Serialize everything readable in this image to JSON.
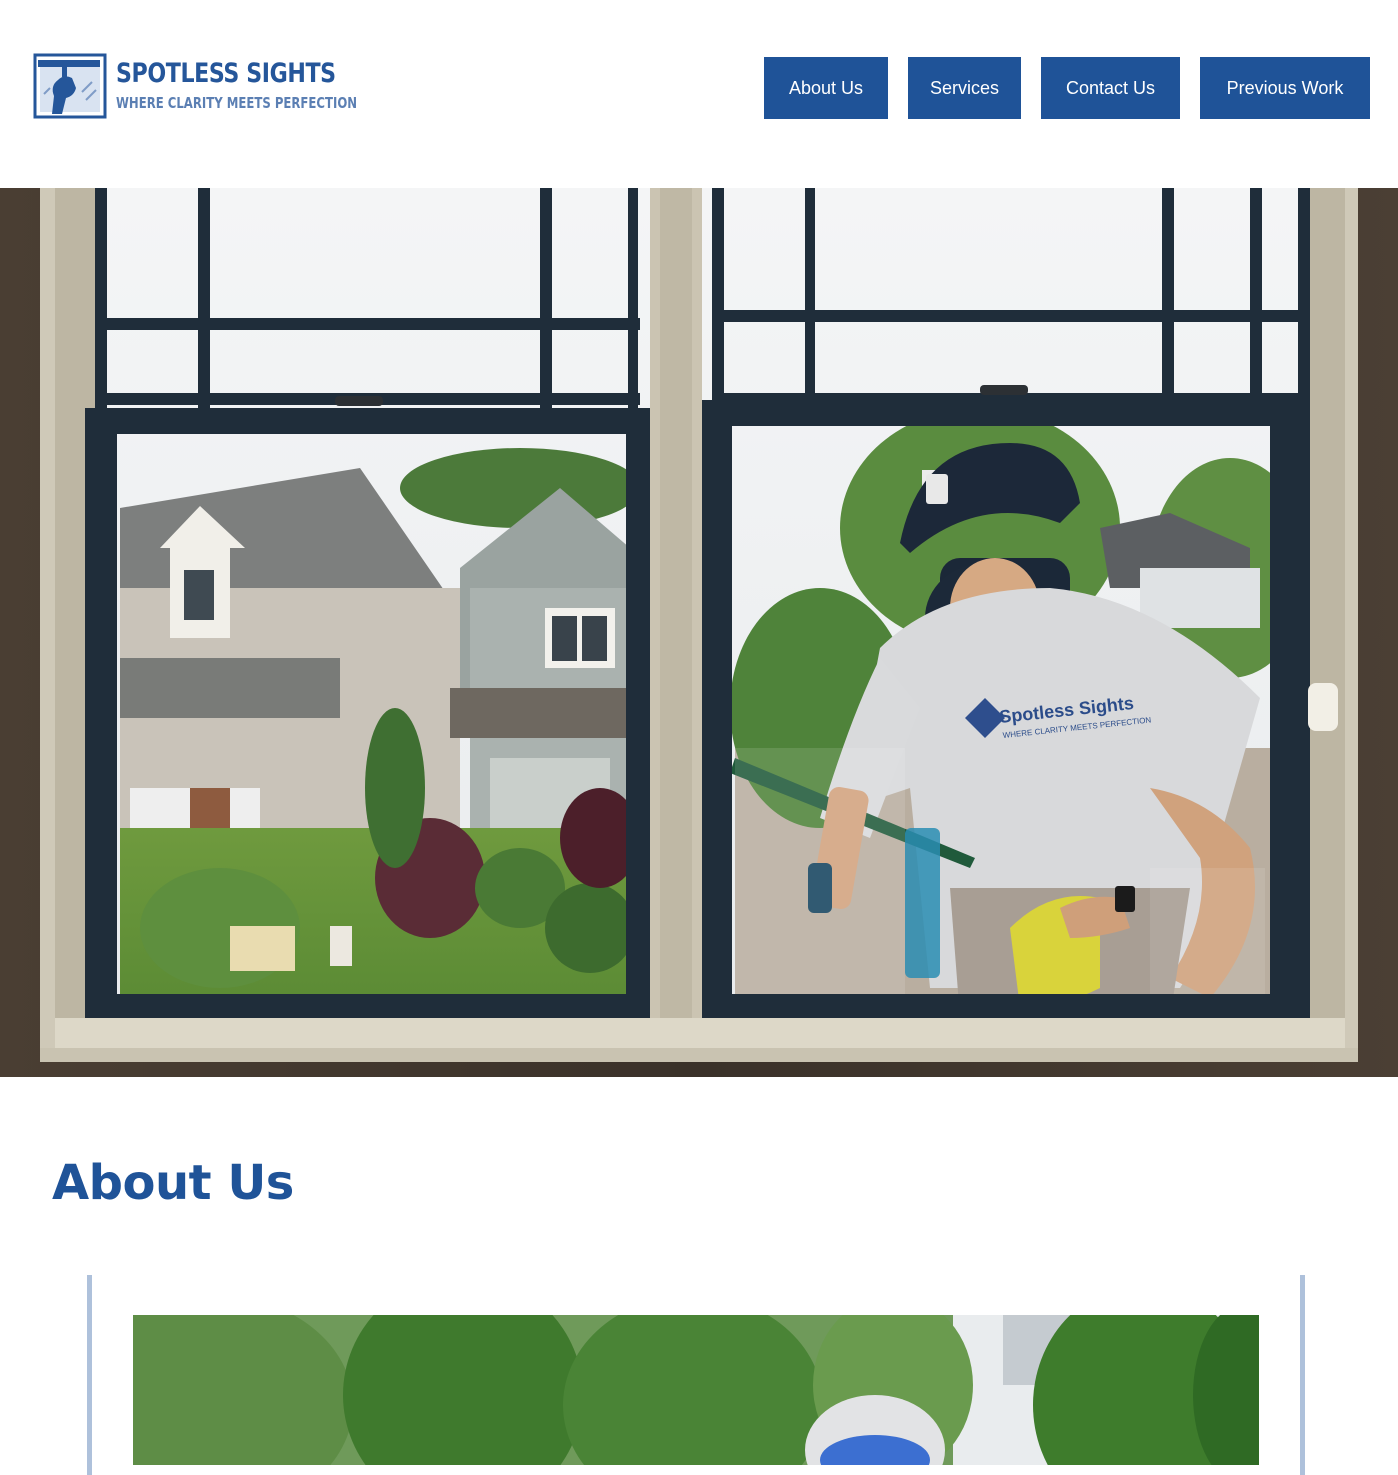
{
  "brand": {
    "name": "Spotless Sights",
    "tagline": "Where Clarity Meets Perfection",
    "name_display": "SPOTLESS SIGHTS",
    "tagline_display": "WHERE CLARITY MEETS PERFECTION",
    "primary_color": "#1f5398",
    "logo_color": "#25569a"
  },
  "nav": {
    "items": [
      {
        "label": "About Us"
      },
      {
        "label": "Services"
      },
      {
        "label": "Contact Us"
      },
      {
        "label": "Previous Work"
      }
    ]
  },
  "hero": {
    "shirt_text": "Spotless Sights",
    "shirt_tagline": "WHERE CLARITY MEETS PERFECTION"
  },
  "about": {
    "heading": "About Us"
  }
}
